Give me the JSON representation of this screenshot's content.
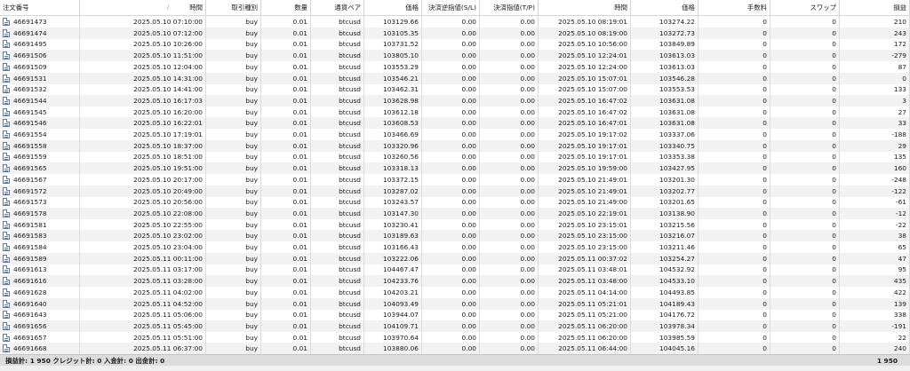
{
  "columns": [
    {
      "key": "order",
      "label": "注文番号",
      "align": "left"
    },
    {
      "key": "time_open",
      "label": "時間",
      "align": "right"
    },
    {
      "key": "type",
      "label": "取引種別",
      "align": "right"
    },
    {
      "key": "volume",
      "label": "数量",
      "align": "right"
    },
    {
      "key": "symbol",
      "label": "通貨ペア",
      "align": "right"
    },
    {
      "key": "price_open",
      "label": "価格",
      "align": "right"
    },
    {
      "key": "sl",
      "label": "決済逆指値(S/L)",
      "align": "right"
    },
    {
      "key": "tp",
      "label": "決済指値(T/P)",
      "align": "right"
    },
    {
      "key": "time_close",
      "label": "時間",
      "align": "right"
    },
    {
      "key": "price_close",
      "label": "価格",
      "align": "right"
    },
    {
      "key": "commission",
      "label": "手数料",
      "align": "right"
    },
    {
      "key": "swap",
      "label": "スワップ",
      "align": "right"
    },
    {
      "key": "profit",
      "label": "損益",
      "align": "right"
    }
  ],
  "sort_indicator": "/",
  "rows": [
    [
      "46691473",
      "2025.05.10 07:10:00",
      "buy",
      "0.01",
      "btcusd",
      "103129.66",
      "0.00",
      "0.00",
      "2025.05.10 08:19:01",
      "103274.22",
      "0",
      "0",
      "210"
    ],
    [
      "46691474",
      "2025.05.10 07:12:00",
      "buy",
      "0.01",
      "btcusd",
      "103105.35",
      "0.00",
      "0.00",
      "2025.05.10 08:19:00",
      "103272.73",
      "0",
      "0",
      "243"
    ],
    [
      "46691495",
      "2025.05.10 10:26:00",
      "buy",
      "0.01",
      "btcusd",
      "103731.52",
      "0.00",
      "0.00",
      "2025.05.10 10:56:00",
      "103849.89",
      "0",
      "0",
      "172"
    ],
    [
      "46691506",
      "2025.05.10 11:51:00",
      "buy",
      "0.01",
      "btcusd",
      "103805.10",
      "0.00",
      "0.00",
      "2025.05.10 12:24:01",
      "103613.03",
      "0",
      "0",
      "-279"
    ],
    [
      "46691509",
      "2025.05.10 12:04:00",
      "buy",
      "0.01",
      "btcusd",
      "103553.29",
      "0.00",
      "0.00",
      "2025.05.10 12:24:00",
      "103613.03",
      "0",
      "0",
      "87"
    ],
    [
      "46691531",
      "2025.05.10 14:31:00",
      "buy",
      "0.01",
      "btcusd",
      "103546.21",
      "0.00",
      "0.00",
      "2025.05.10 15:07:01",
      "103546.28",
      "0",
      "0",
      "0"
    ],
    [
      "46691532",
      "2025.05.10 14:41:00",
      "buy",
      "0.01",
      "btcusd",
      "103462.31",
      "0.00",
      "0.00",
      "2025.05.10 15:07:00",
      "103553.53",
      "0",
      "0",
      "133"
    ],
    [
      "46691544",
      "2025.05.10 16:17:03",
      "buy",
      "0.01",
      "btcusd",
      "103628.98",
      "0.00",
      "0.00",
      "2025.05.10 16:47:02",
      "103631.08",
      "0",
      "0",
      "3"
    ],
    [
      "46691545",
      "2025.05.10 16:20:00",
      "buy",
      "0.01",
      "btcusd",
      "103612.18",
      "0.00",
      "0.00",
      "2025.05.10 16:47:02",
      "103631.08",
      "0",
      "0",
      "27"
    ],
    [
      "46691546",
      "2025.05.10 16:22:01",
      "buy",
      "0.01",
      "btcusd",
      "103608.53",
      "0.00",
      "0.00",
      "2025.05.10 16:47:01",
      "103631.08",
      "0",
      "0",
      "33"
    ],
    [
      "46691554",
      "2025.05.10 17:19:01",
      "buy",
      "0.01",
      "btcusd",
      "103466.69",
      "0.00",
      "0.00",
      "2025.05.10 19:17:02",
      "103337.06",
      "0",
      "0",
      "-188"
    ],
    [
      "46691558",
      "2025.05.10 18:37:00",
      "buy",
      "0.01",
      "btcusd",
      "103320.96",
      "0.00",
      "0.00",
      "2025.05.10 19:17:01",
      "103340.75",
      "0",
      "0",
      "29"
    ],
    [
      "46691559",
      "2025.05.10 18:51:00",
      "buy",
      "0.01",
      "btcusd",
      "103260.56",
      "0.00",
      "0.00",
      "2025.05.10 19:17:01",
      "103353.38",
      "0",
      "0",
      "135"
    ],
    [
      "46691565",
      "2025.05.10 19:51:00",
      "buy",
      "0.01",
      "btcusd",
      "103318.13",
      "0.00",
      "0.00",
      "2025.05.10 19:59:00",
      "103427.95",
      "0",
      "0",
      "160"
    ],
    [
      "46691567",
      "2025.05.10 20:17:00",
      "buy",
      "0.01",
      "btcusd",
      "103372.15",
      "0.00",
      "0.00",
      "2025.05.10 21:49:01",
      "103201.30",
      "0",
      "0",
      "-248"
    ],
    [
      "46691572",
      "2025.05.10 20:49:00",
      "buy",
      "0.01",
      "btcusd",
      "103287.02",
      "0.00",
      "0.00",
      "2025.05.10 21:49:01",
      "103202.77",
      "0",
      "0",
      "-122"
    ],
    [
      "46691573",
      "2025.05.10 20:56:00",
      "buy",
      "0.01",
      "btcusd",
      "103243.57",
      "0.00",
      "0.00",
      "2025.05.10 21:49:00",
      "103201.65",
      "0",
      "0",
      "-61"
    ],
    [
      "46691578",
      "2025.05.10 22:08:00",
      "buy",
      "0.01",
      "btcusd",
      "103147.30",
      "0.00",
      "0.00",
      "2025.05.10 22:19:01",
      "103138.90",
      "0",
      "0",
      "-12"
    ],
    [
      "46691581",
      "2025.05.10 22:55:00",
      "buy",
      "0.01",
      "btcusd",
      "103230.41",
      "0.00",
      "0.00",
      "2025.05.10 23:15:01",
      "103215.56",
      "0",
      "0",
      "-22"
    ],
    [
      "46691583",
      "2025.05.10 23:02:00",
      "buy",
      "0.01",
      "btcusd",
      "103189.63",
      "0.00",
      "0.00",
      "2025.05.10 23:15:00",
      "103216.07",
      "0",
      "0",
      "38"
    ],
    [
      "46691584",
      "2025.05.10 23:04:00",
      "buy",
      "0.01",
      "btcusd",
      "103166.43",
      "0.00",
      "0.00",
      "2025.05.10 23:15:00",
      "103211.46",
      "0",
      "0",
      "65"
    ],
    [
      "46691589",
      "2025.05.11 00:11:00",
      "buy",
      "0.01",
      "btcusd",
      "103222.06",
      "0.00",
      "0.00",
      "2025.05.11 00:37:02",
      "103254.27",
      "0",
      "0",
      "47"
    ],
    [
      "46691613",
      "2025.05.11 03:17:00",
      "buy",
      "0.01",
      "btcusd",
      "104467.47",
      "0.00",
      "0.00",
      "2025.05.11 03:48:01",
      "104532.92",
      "0",
      "0",
      "95"
    ],
    [
      "46691616",
      "2025.05.11 03:28:00",
      "buy",
      "0.01",
      "btcusd",
      "104233.76",
      "0.00",
      "0.00",
      "2025.05.11 03:48:00",
      "104533.10",
      "0",
      "0",
      "435"
    ],
    [
      "46691628",
      "2025.05.11 04:02:00",
      "buy",
      "0.01",
      "btcusd",
      "104203.21",
      "0.00",
      "0.00",
      "2025.05.11 04:14:00",
      "104493.85",
      "0",
      "0",
      "422"
    ],
    [
      "46691640",
      "2025.05.11 04:52:00",
      "buy",
      "0.01",
      "btcusd",
      "104093.49",
      "0.00",
      "0.00",
      "2025.05.11 05:21:01",
      "104189.43",
      "0",
      "0",
      "139"
    ],
    [
      "46691643",
      "2025.05.11 05:06:00",
      "buy",
      "0.01",
      "btcusd",
      "103944.07",
      "0.00",
      "0.00",
      "2025.05.11 05:21:00",
      "104176.72",
      "0",
      "0",
      "338"
    ],
    [
      "46691656",
      "2025.05.11 05:45:00",
      "buy",
      "0.01",
      "btcusd",
      "104109.71",
      "0.00",
      "0.00",
      "2025.05.11 06:20:00",
      "103978.34",
      "0",
      "0",
      "-191"
    ],
    [
      "46691657",
      "2025.05.11 05:51:00",
      "buy",
      "0.01",
      "btcusd",
      "103970.64",
      "0.00",
      "0.00",
      "2025.05.11 06:20:00",
      "103985.59",
      "0",
      "0",
      "22"
    ],
    [
      "46691668",
      "2025.05.11 06:37:00",
      "buy",
      "0.01",
      "btcusd",
      "103880.06",
      "0.00",
      "0.00",
      "2025.05.11 06:44:00",
      "104045.16",
      "0",
      "0",
      "240"
    ]
  ],
  "summary": {
    "text": "損益計: 1 950  クレジット計: 0  入金計: 0  出金計: 0",
    "total": "1 950"
  },
  "colors": {
    "stripe": "#f2f2f2",
    "summary_bg": "#dcdcdc",
    "icon": "#5a78a8"
  },
  "icons": {
    "row": "document-icon"
  }
}
